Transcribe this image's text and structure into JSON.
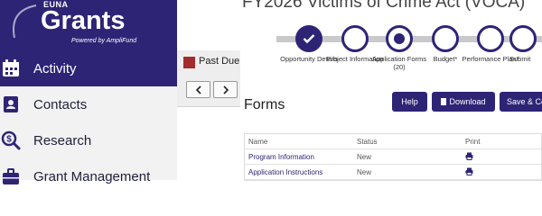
{
  "brand": {
    "small": "EUNA",
    "name": "Grants",
    "powered": "Powered by AmpliFund",
    "color": "#2e2476"
  },
  "sidebar": {
    "items": [
      {
        "label": "Activity",
        "icon": "calendar-icon",
        "active": true
      },
      {
        "label": "Contacts",
        "icon": "contact-card-icon",
        "active": false
      },
      {
        "label": "Research",
        "icon": "search-dollar-icon",
        "active": false
      },
      {
        "label": "Grant Management",
        "icon": "briefcase-icon",
        "active": false
      }
    ]
  },
  "middle": {
    "past_due_label": "Past Due",
    "past_due_color": "#a32c2c",
    "prev_icon": "chevron-left-icon",
    "next_icon": "chevron-right-icon"
  },
  "main": {
    "title": "FY2026 Victims of Crime Act (VOCA)"
  },
  "stepper": {
    "steps": [
      {
        "label": "Opportunity Details",
        "state": "done"
      },
      {
        "label": "Project Information",
        "state": "todo"
      },
      {
        "label": "Application Forms (20)",
        "state": "current"
      },
      {
        "label": "Budget*",
        "state": "todo"
      },
      {
        "label": "Performance Plan*",
        "state": "todo"
      },
      {
        "label": "Submit",
        "state": "todo"
      }
    ]
  },
  "forms": {
    "title": "Forms",
    "help_label": "Help",
    "download_label": "Download",
    "save_label": "Save & Co"
  },
  "table": {
    "headers": [
      "Name",
      "Status",
      "Print"
    ],
    "rows": [
      {
        "name": "Program Information",
        "status": "New"
      },
      {
        "name": "Application Instructions",
        "status": "New"
      }
    ]
  }
}
